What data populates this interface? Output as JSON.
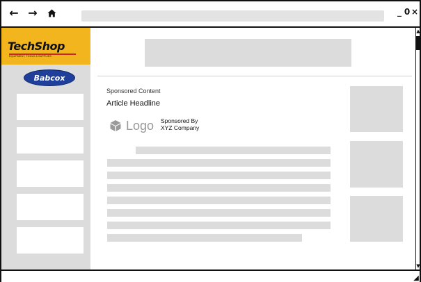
{
  "browser": {
    "icons": [
      "back-icon",
      "forward-icon",
      "home-icon"
    ],
    "address_value": "",
    "window_controls": {
      "minimize": "_",
      "maximize": "0",
      "close": "×"
    }
  },
  "sidebar": {
    "brand_primary": {
      "name": "TechShop",
      "tagline": "EQUIPMENT, TOOLS & SUPPLIES",
      "color": "#f2b51d"
    },
    "brand_secondary": {
      "name": "Babcox",
      "color": "#1f3f9a"
    },
    "slot_count": 5
  },
  "main": {
    "sponsored_label": "Sponsored Content",
    "headline": "Article Headline",
    "sponsor": {
      "logo_text": "Logo",
      "sponsored_by_label": "Sponsored By",
      "company": "XYZ Company"
    }
  },
  "colors": {
    "placeholder": "#dcdcdc",
    "address_bar": "#e3e3e3",
    "border": "#111111"
  }
}
